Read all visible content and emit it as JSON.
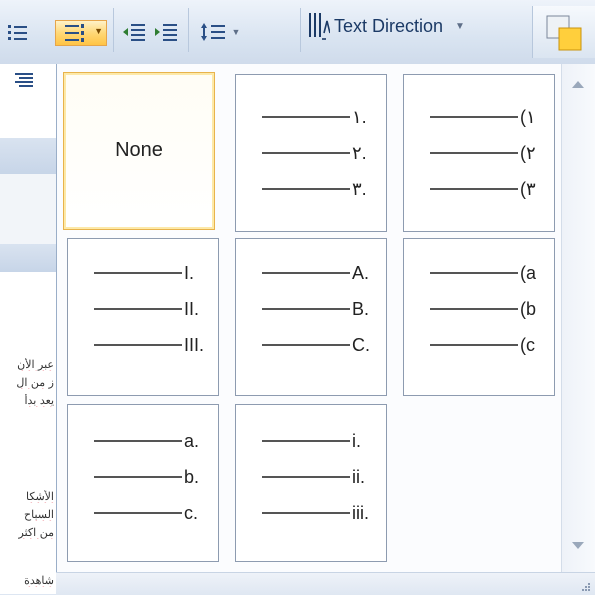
{
  "ribbon": {
    "text_direction_label": "Text Direction",
    "dropdown_arrow": "▼"
  },
  "gallery": {
    "none_label": "None",
    "tiles": [
      {
        "name": "tile-none"
      },
      {
        "name": "tile-arabic-indic-dot",
        "items": [
          "١.",
          "٢.",
          "٣."
        ]
      },
      {
        "name": "tile-arabic-indic-paren",
        "items": [
          "(١",
          "(٢",
          "(٣"
        ]
      },
      {
        "name": "tile-upper-roman",
        "items": [
          "I.",
          "II.",
          "III."
        ]
      },
      {
        "name": "tile-upper-alpha",
        "items": [
          "A.",
          "B.",
          "C."
        ]
      },
      {
        "name": "tile-lower-alpha-paren",
        "items": [
          "(a",
          "(b",
          "(c"
        ]
      },
      {
        "name": "tile-lower-alpha",
        "items": [
          "a.",
          "b.",
          "c."
        ]
      },
      {
        "name": "tile-lower-roman",
        "items": [
          "i.",
          "ii.",
          "iii."
        ]
      }
    ]
  },
  "document_strip": {
    "lines": [
      "عبر الأن",
      "ز من ال",
      "يعد بدأ",
      "الأشكا",
      "السباح",
      "من اكثر",
      "شاهدة"
    ]
  },
  "colors": {
    "selected_border": "#e8b34c",
    "ribbon_text": "#1b3a66"
  }
}
